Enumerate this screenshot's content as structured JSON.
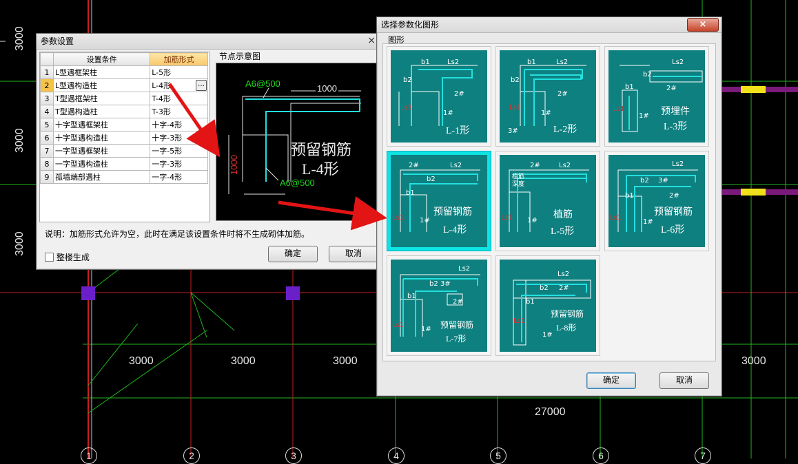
{
  "cad": {
    "dims_vertical": [
      "3000",
      "3000",
      "3000"
    ],
    "dims_bottom": [
      "3000",
      "3000",
      "3000",
      "3000"
    ],
    "dim_total": "27000",
    "axis_labels": [
      "1",
      "2",
      "3",
      "4",
      "5",
      "6",
      "7"
    ],
    "colors": {
      "grid_red": "#c81e1e",
      "grid_green": "#1fb81f",
      "column_purple": "#6a1fc9",
      "beam_yellow": "#f0e21a"
    }
  },
  "param_dialog": {
    "title": "参数设置",
    "close_glyph": "×",
    "columns": [
      "设置条件",
      "加筋形式"
    ],
    "rows": [
      {
        "n": "1",
        "cond": "L型遇框架柱",
        "form": "L-5形"
      },
      {
        "n": "2",
        "cond": "L型遇构造柱",
        "form": "L-4形"
      },
      {
        "n": "3",
        "cond": "T型遇框架柱",
        "form": "T-4形"
      },
      {
        "n": "4",
        "cond": "T型遇构造柱",
        "form": "T-3形"
      },
      {
        "n": "5",
        "cond": "十字型遇框架柱",
        "form": "十字-4形"
      },
      {
        "n": "6",
        "cond": "十字型遇构造柱",
        "form": "十字-3形"
      },
      {
        "n": "7",
        "cond": "一字型遇框架柱",
        "form": "一字-5形"
      },
      {
        "n": "8",
        "cond": "一字型遇构造柱",
        "form": "一字-3形"
      },
      {
        "n": "9",
        "cond": "孤墙端部遇柱",
        "form": "一字-4形"
      }
    ],
    "ellipsis": "…",
    "preview_label": "节点示意图",
    "preview": {
      "rebar1": "A6@500",
      "rebar2": "A6@500",
      "len": "1000",
      "vlen": "1000",
      "title1": "预留钢筋",
      "title2": "L-4形"
    },
    "note": "说明：加筋形式允许为空，此时在满足该设置条件时将不生成砌体加筋。",
    "checkbox_label": "整楼生成",
    "ok": "确定",
    "cancel": "取消"
  },
  "shape_dialog": {
    "title": "选择参数化图形",
    "close_glyph": "×",
    "group_label": "图形",
    "tiles": [
      {
        "name": "L-1形",
        "lines": [
          "L-1形"
        ],
        "tags": [
          "b1",
          "Ls2",
          "b2",
          "2#",
          "Ls1",
          "1#"
        ]
      },
      {
        "name": "L-2形",
        "lines": [
          "L-2形"
        ],
        "tags": [
          "b1",
          "Ls2",
          "b2",
          "2#",
          "Ls1",
          "1#",
          "3#"
        ]
      },
      {
        "name": "L-3形",
        "lines": [
          "预埋件",
          "L-3形"
        ],
        "tags": [
          "Ls2",
          "b2",
          "b1",
          "2#",
          "Ls1",
          "1#"
        ]
      },
      {
        "name": "L-4形",
        "lines": [
          "预留钢筋",
          "L-4形"
        ],
        "tags": [
          "2#",
          "Ls2",
          "b2",
          "b1",
          "Ls1",
          "1#"
        ]
      },
      {
        "name": "L-5形",
        "lines": [
          "植筋",
          "L-5形"
        ],
        "tags": [
          "2#",
          "Ls2",
          "植筋",
          "深度",
          "Ls1",
          "1#"
        ]
      },
      {
        "name": "L-6形",
        "lines": [
          "预留钢筋",
          "L-6形"
        ],
        "tags": [
          "Ls2",
          "b2",
          "3#",
          "b1",
          "2#",
          "Ls1",
          "1#"
        ]
      },
      {
        "name": "L-7形",
        "lines": [
          "预留钢筋",
          "L-7形"
        ],
        "tags": [
          "Ls2",
          "b2",
          "3#",
          "b1",
          "2#",
          "Ls1",
          "1#"
        ]
      },
      {
        "name": "L-8形",
        "lines": [
          "预留钢筋",
          "L-8形"
        ],
        "tags": [
          "Ls2",
          "b2",
          "2#",
          "b1",
          "Ls1",
          "1#"
        ]
      }
    ],
    "selected": "L-4形",
    "ok": "确定",
    "cancel": "取消"
  }
}
